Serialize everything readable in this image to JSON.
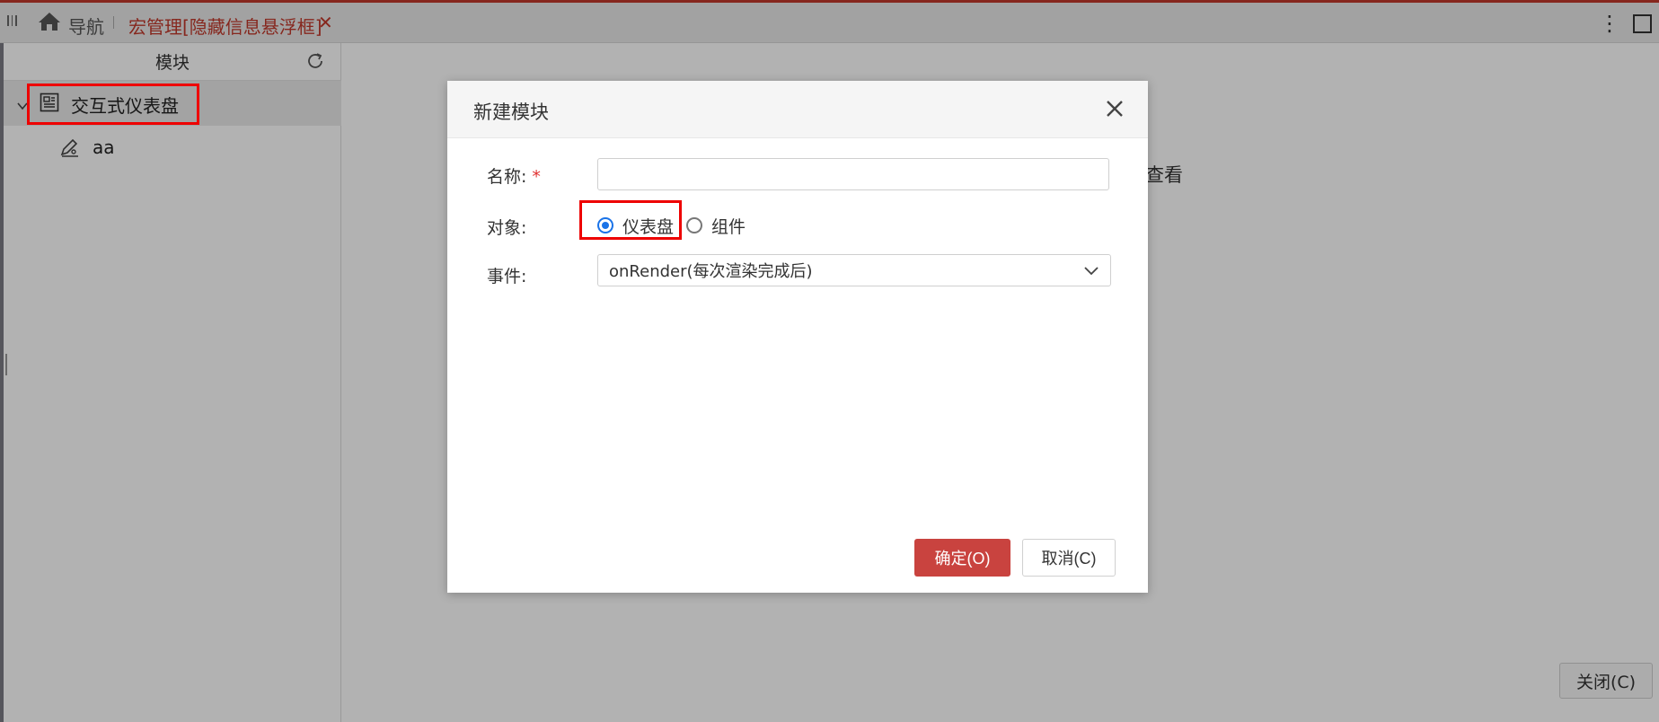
{
  "colors": {
    "accent": "#c0392b",
    "primary_button": "#c9433f",
    "radio_selected": "#1a73e8",
    "highlight_box": "#e00000",
    "overlay": "rgba(0,0,0,0.30)"
  },
  "tabs": {
    "hamburger_icon": "menu-lines-icon",
    "home_icon": "home-icon",
    "nav_label": "导航",
    "active_tab_label": "宏管理[隐藏信息悬浮框]",
    "close_symbol": "✕",
    "more_icon": "kebab-icon",
    "maximize_icon": "maximize-icon"
  },
  "sidebar": {
    "header": "模块",
    "refresh_icon": "refresh-icon",
    "tree": {
      "root_label": "交互式仪表盘",
      "root_icon": "dashboard-icon",
      "expanded": true,
      "children": [
        {
          "label": "aa",
          "icon": "pen-icon"
        }
      ]
    }
  },
  "main": {
    "behind_text": "查看",
    "close_button": "关闭(C)"
  },
  "dialog": {
    "title": "新建模块",
    "close_icon": "close-icon",
    "fields": {
      "name_label": "名称:",
      "name_required_mark": "*",
      "name_value": "",
      "object_label": "对象:",
      "object_options": [
        {
          "label": "仪表盘",
          "checked": true
        },
        {
          "label": "组件",
          "checked": false
        }
      ],
      "event_label": "事件:",
      "event_value": "onRender(每次渲染完成后)"
    },
    "ok_button": "确定(O)",
    "cancel_button": "取消(C)"
  }
}
